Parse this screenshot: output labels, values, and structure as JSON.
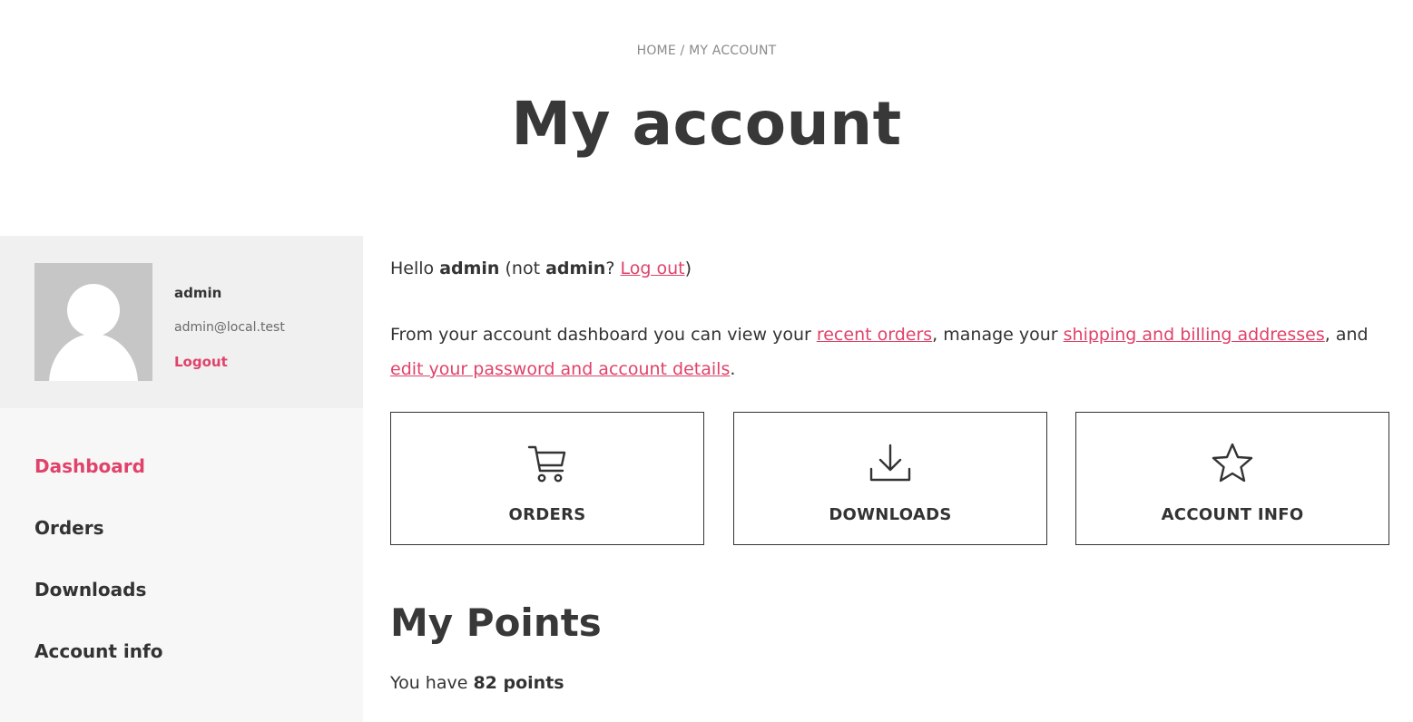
{
  "breadcrumb": {
    "home": "HOME",
    "separator": " / ",
    "current": "MY ACCOUNT"
  },
  "page_title": "My account",
  "profile": {
    "name": "admin",
    "email": "admin@local.test",
    "logout": "Logout"
  },
  "nav": {
    "items": [
      {
        "label": "Dashboard",
        "active": true
      },
      {
        "label": "Orders",
        "active": false
      },
      {
        "label": "Downloads",
        "active": false
      },
      {
        "label": "Account info",
        "active": false
      }
    ]
  },
  "greeting": {
    "hello": "Hello ",
    "user": "admin",
    "not_open": " (not ",
    "user2": "admin",
    "question": "? ",
    "logout_link": "Log out",
    "close": ")"
  },
  "intro": {
    "part1": "From your account dashboard you can view your ",
    "link1": "recent orders",
    "part2": ", manage your ",
    "link2": "shipping and billing addresses",
    "part3": ", and ",
    "link3": "edit your password and account details",
    "part4": "."
  },
  "cards": [
    {
      "label": "ORDERS",
      "icon": "cart-icon"
    },
    {
      "label": "DOWNLOADS",
      "icon": "download-icon"
    },
    {
      "label": "ACCOUNT INFO",
      "icon": "star-icon"
    }
  ],
  "points": {
    "title": "My Points",
    "prefix": "You have ",
    "value": "82 points"
  },
  "colors": {
    "accent": "#e0426a",
    "text": "#333333",
    "sidebar_bg": "#f7f7f7",
    "profile_bg": "#f0f0f0"
  }
}
